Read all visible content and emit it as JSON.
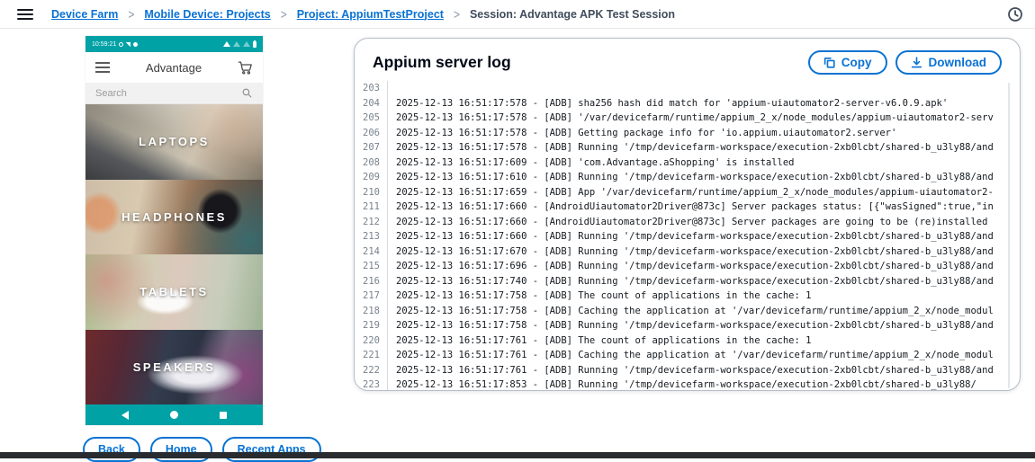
{
  "colors": {
    "accent_blue": "#0972d3",
    "device_teal": "#01a2a6",
    "breadcrumb_current": "#414d5c",
    "log_number_gray": "#78828e",
    "bottom_strip": "#282c31"
  },
  "topbar": {
    "breadcrumbs": [
      {
        "label": "Device Farm",
        "link": true
      },
      {
        "label": "Mobile Device: Projects",
        "link": true
      },
      {
        "label": "Project: AppiumTestProject",
        "link": true
      },
      {
        "label": "Session: Advantage APK Test Session",
        "link": false
      }
    ],
    "separator": ">"
  },
  "device": {
    "status_bar": {
      "time": "10:59:21"
    },
    "app_bar": {
      "title": "Advantage"
    },
    "search": {
      "placeholder": "Search"
    },
    "categories": [
      "LAPTOPS",
      "HEADPHONES",
      "TABLETS",
      "SPEAKERS"
    ]
  },
  "device_controls": {
    "buttons": [
      "Back",
      "Home",
      "Recent Apps"
    ]
  },
  "log_panel": {
    "title": "Appium server log",
    "copy_label": "Copy",
    "download_label": "Download",
    "lines": [
      {
        "num": "203",
        "text": ""
      },
      {
        "num": "204",
        "text": "2025-12-13 16:51:17:578 - [ADB] sha256 hash did match for 'appium-uiautomator2-server-v6.0.9.apk'"
      },
      {
        "num": "205",
        "text": "2025-12-13 16:51:17:578 - [ADB] '/var/devicefarm/runtime/appium_2_x/node_modules/appium-uiautomator2-serv"
      },
      {
        "num": "206",
        "text": "2025-12-13 16:51:17:578 - [ADB] Getting package info for 'io.appium.uiautomator2.server'"
      },
      {
        "num": "207",
        "text": "2025-12-13 16:51:17:578 - [ADB] Running '/tmp/devicefarm-workspace/execution-2xb0lcbt/shared-b_u3ly88/and"
      },
      {
        "num": "208",
        "text": "2025-12-13 16:51:17:609 - [ADB] 'com.Advantage.aShopping' is installed"
      },
      {
        "num": "209",
        "text": "2025-12-13 16:51:17:610 - [ADB] Running '/tmp/devicefarm-workspace/execution-2xb0lcbt/shared-b_u3ly88/and"
      },
      {
        "num": "210",
        "text": "2025-12-13 16:51:17:659 - [ADB] App '/var/devicefarm/runtime/appium_2_x/node_modules/appium-uiautomator2-"
      },
      {
        "num": "211",
        "text": "2025-12-13 16:51:17:660 - [AndroidUiautomator2Driver@873c] Server packages status: [{\"wasSigned\":true,\"in"
      },
      {
        "num": "212",
        "text": "2025-12-13 16:51:17:660 - [AndroidUiautomator2Driver@873c] Server packages are going to be (re)installed "
      },
      {
        "num": "213",
        "text": "2025-12-13 16:51:17:660 - [ADB] Running '/tmp/devicefarm-workspace/execution-2xb0lcbt/shared-b_u3ly88/and"
      },
      {
        "num": "214",
        "text": "2025-12-13 16:51:17:670 - [ADB] Running '/tmp/devicefarm-workspace/execution-2xb0lcbt/shared-b_u3ly88/and"
      },
      {
        "num": "215",
        "text": "2025-12-13 16:51:17:696 - [ADB] Running '/tmp/devicefarm-workspace/execution-2xb0lcbt/shared-b_u3ly88/and"
      },
      {
        "num": "216",
        "text": "2025-12-13 16:51:17:740 - [ADB] Running '/tmp/devicefarm-workspace/execution-2xb0lcbt/shared-b_u3ly88/and"
      },
      {
        "num": "217",
        "text": "2025-12-13 16:51:17:758 - [ADB] The count of applications in the cache: 1"
      },
      {
        "num": "218",
        "text": "2025-12-13 16:51:17:758 - [ADB] Caching the application at '/var/devicefarm/runtime/appium_2_x/node_modul"
      },
      {
        "num": "219",
        "text": "2025-12-13 16:51:17:758 - [ADB] Running '/tmp/devicefarm-workspace/execution-2xb0lcbt/shared-b_u3ly88/and"
      },
      {
        "num": "220",
        "text": "2025-12-13 16:51:17:761 - [ADB] The count of applications in the cache: 1"
      },
      {
        "num": "221",
        "text": "2025-12-13 16:51:17:761 - [ADB] Caching the application at '/var/devicefarm/runtime/appium_2_x/node_modul"
      },
      {
        "num": "222",
        "text": "2025-12-13 16:51:17:761 - [ADB] Running '/tmp/devicefarm-workspace/execution-2xb0lcbt/shared-b_u3ly88/and"
      },
      {
        "num": "223",
        "text": "2025-12-13 16:51:17:853 - [ADB] Running '/tmp/devicefarm-workspace/execution-2xb0lcbt/shared-b_u3ly88/"
      }
    ]
  }
}
